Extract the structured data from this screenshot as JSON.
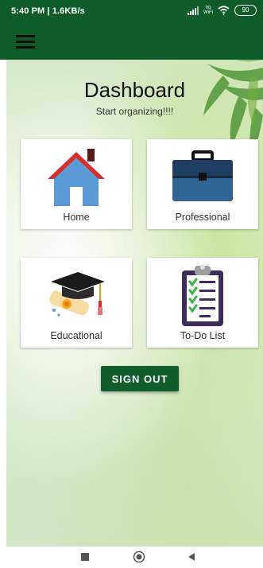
{
  "status_bar": {
    "time": "5:40 PM | 1.6KB/s",
    "vowifi": [
      "Vo",
      "WiFi"
    ],
    "battery": "90",
    "icons": [
      "signal-icon",
      "vowifi-icon",
      "wifi-icon",
      "battery-icon"
    ]
  },
  "app_bar": {
    "menu_icon": "hamburger-menu-icon",
    "color": "#0d5c2a"
  },
  "dashboard": {
    "title": "Dashboard",
    "subtitle": "Start organizing!!!!",
    "cards": [
      {
        "label": "Home",
        "icon": "house-icon"
      },
      {
        "label": "Professional",
        "icon": "briefcase-icon"
      },
      {
        "label": "Educational",
        "icon": "graduation-cap-icon"
      },
      {
        "label": "To-Do List",
        "icon": "clipboard-checklist-icon"
      }
    ],
    "sign_out_label": "SIGN OUT",
    "accent_color": "#0f5e2c"
  },
  "nav_bar": {
    "icons": [
      "recent-apps-icon",
      "home-nav-icon",
      "back-icon"
    ]
  }
}
